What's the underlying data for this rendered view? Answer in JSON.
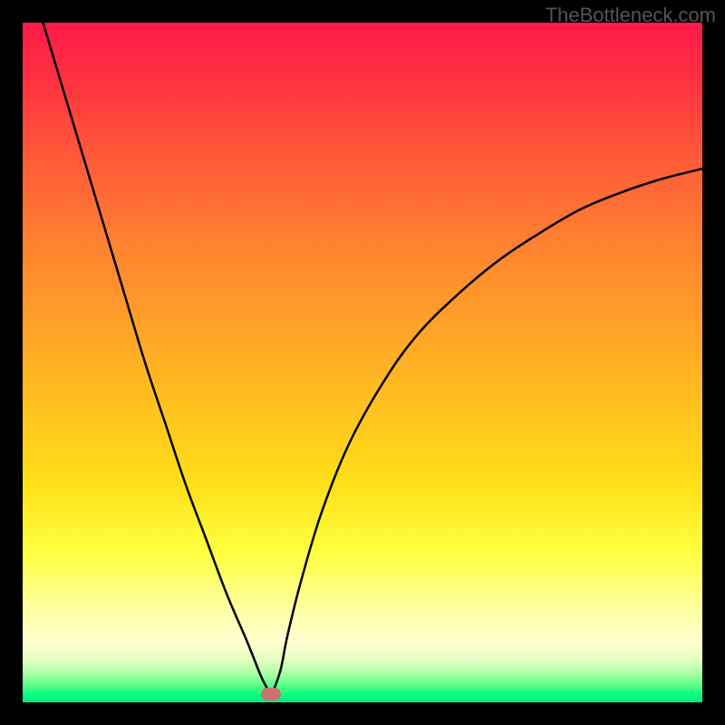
{
  "watermark": "TheBottleneck.com",
  "chart_data": {
    "type": "line",
    "title": "",
    "xlabel": "",
    "ylabel": "",
    "xlim": [
      0,
      100
    ],
    "ylim": [
      0,
      100
    ],
    "series": [
      {
        "name": "bottleneck-curve",
        "x": [
          3,
          6,
          9,
          12,
          15,
          18,
          21,
          24,
          27,
          30,
          33,
          35,
          36,
          36.5,
          37,
          38,
          39,
          41,
          44,
          48,
          53,
          58,
          64,
          70,
          76,
          82,
          88,
          94,
          100
        ],
        "values": [
          100,
          90,
          80,
          70,
          60,
          50,
          41,
          32,
          24,
          16,
          9,
          4,
          2,
          1,
          2,
          5,
          10,
          18,
          28,
          38,
          47,
          54,
          60,
          65,
          69,
          72.5,
          75,
          77,
          78.5
        ]
      }
    ],
    "marker": {
      "x": 36.5,
      "y": 1.2,
      "color": "#c9736b"
    },
    "gradient": {
      "top": "#ff1a4a",
      "mid": "#ffe018",
      "bottom": "#00e878"
    },
    "grid": false,
    "legend": false
  }
}
